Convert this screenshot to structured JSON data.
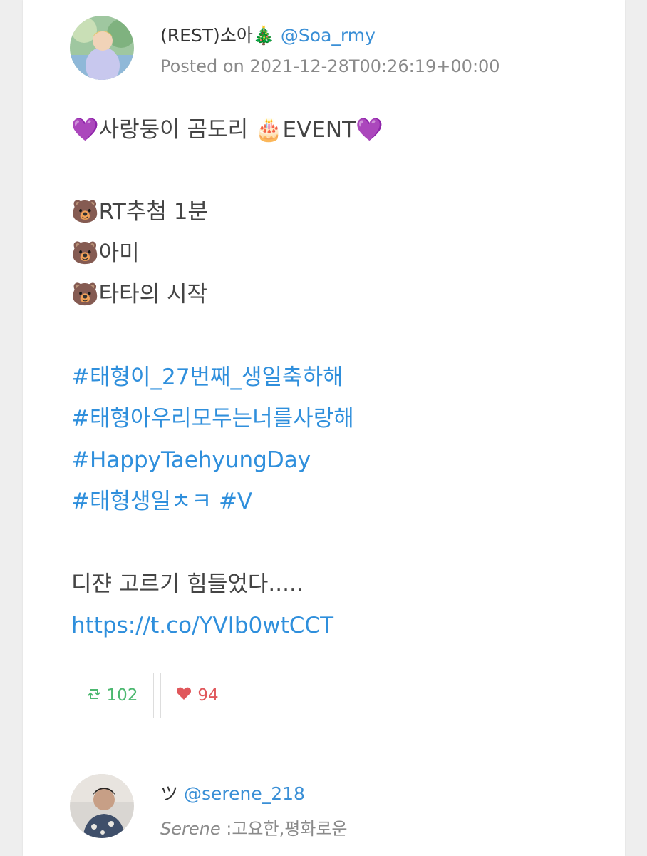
{
  "post": {
    "display_name": "(REST)소아🎄",
    "handle": "@Soa_rmy",
    "posted": "Posted on 2021-12-28T00:26:19+00:00",
    "lines": {
      "title": "💜사랑둥이 곰도리 🎂EVENT💜",
      "item1": "🐻RT추첨 1분",
      "item2": "🐻아미",
      "item3": "🐻타타의 시작"
    },
    "hashtags": [
      "#태형이_27번째_생일축하해",
      "#태형아우리모두는너를사랑해",
      "#HappyTaehyungDay",
      "#태형생일ㅊㅋ #V"
    ],
    "closing": "디쟌 고르기 힘들었다.....",
    "link": "https://t.co/YVIb0wtCCT",
    "retweets": "102",
    "likes": "94",
    "colors": {
      "handle": "#3a8fd6",
      "hashtag": "#2f8fdc",
      "retweet": "#4cb870",
      "like": "#e0575b"
    },
    "icons": {
      "retweet": "retweet-icon",
      "like": "heart-icon"
    }
  },
  "reply": {
    "display_name": "ツ",
    "handle": "@serene_218",
    "bio_italic": "Serene",
    "bio_rest": " :고요한,평화로운"
  }
}
